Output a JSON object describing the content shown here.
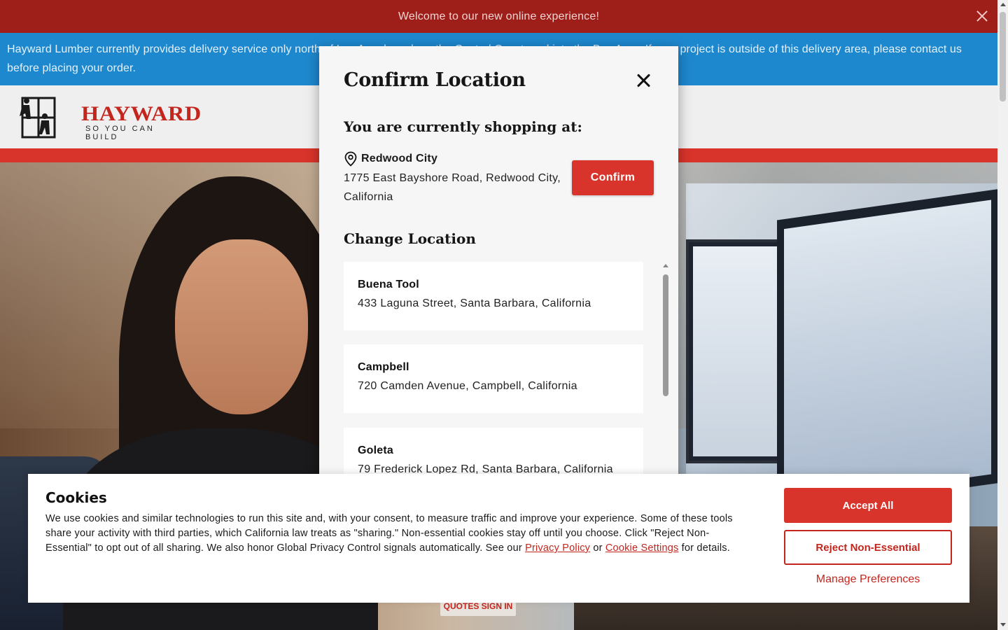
{
  "welcome_bar": {
    "text": "Welcome to our new online experience!"
  },
  "notice_bar": {
    "text": "Hayward Lumber currently provides delivery service only north of Los Angeles, along the Central Coast, and into the Bay Area. If your project is outside of this delivery area, please contact us before placing your order."
  },
  "header": {
    "logo_word": "HAYWARD",
    "logo_tagline": "SO YOU CAN BUILD"
  },
  "hero": {
    "quotes_signin": "QUOTES SIGN IN"
  },
  "modal": {
    "title": "Confirm Location",
    "current_heading": "You are currently shopping at:",
    "current_store": {
      "name": "Redwood City",
      "address": "1775 East Bayshore Road, Redwood City, California"
    },
    "confirm_label": "Confirm",
    "change_heading": "Change Location",
    "locations": [
      {
        "name": "Buena Tool",
        "address": "433 Laguna Street, Santa Barbara, California"
      },
      {
        "name": "Campbell",
        "address": "720 Camden Avenue, Campbell, California"
      },
      {
        "name": "Goleta",
        "address": "79 Frederick Lopez Rd, Santa Barbara, California"
      }
    ]
  },
  "cookie": {
    "title": "Cookies",
    "text_before": "We use cookies and similar technologies to run this site and, with your consent, to measure traffic and improve your experience. Some of these tools share your activity with third parties, which California law treats as \"sharing.\" Non-essential cookies stay off until you choose. Click \"Reject Non-Essential\" to opt out of all sharing. We also honor Global Privacy Control signals automatically. See our ",
    "privacy_link": "Privacy Policy",
    "text_or": " or ",
    "settings_link": "Cookie Settings",
    "text_after": " for details.",
    "accept_label": "Accept All",
    "reject_label": "Reject Non-Essential",
    "manage_label": "Manage Preferences"
  },
  "colors": {
    "brand_red": "#d9342b",
    "welcome_red": "#9e1f1a",
    "notice_blue": "#1e88cf"
  },
  "icons": {
    "welcome_close": "close-icon",
    "modal_close": "close-icon",
    "store_pin": "map-pin-icon"
  }
}
